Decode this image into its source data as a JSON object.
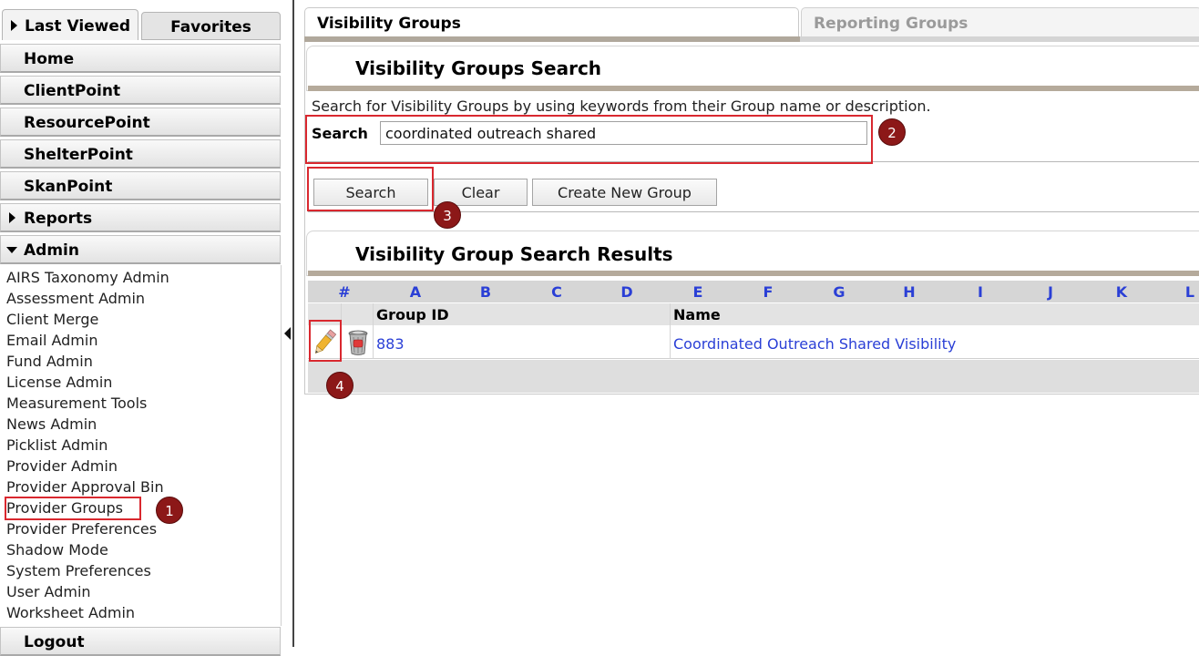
{
  "sidebar": {
    "tabs": [
      "Last Viewed",
      "Favorites"
    ],
    "nav": [
      "Home",
      "ClientPoint",
      "ResourcePoint",
      "ShelterPoint",
      "SkanPoint",
      "Reports",
      "Admin"
    ],
    "admin_items": [
      "AIRS Taxonomy Admin",
      "Assessment Admin",
      "Client Merge",
      "Email Admin",
      "Fund Admin",
      "License Admin",
      "Measurement Tools",
      "News Admin",
      "Picklist Admin",
      "Provider Admin",
      "Provider Approval Bin",
      "Provider Groups",
      "Provider Preferences",
      "Shadow Mode",
      "System Preferences",
      "User Admin",
      "Worksheet Admin"
    ],
    "logout": "Logout"
  },
  "main": {
    "tabs": [
      "Visibility Groups",
      "Reporting Groups"
    ],
    "search_section": {
      "title": "Visibility Groups Search",
      "description": "Search for Visibility Groups by using keywords from their Group name or description.",
      "search_label": "Search",
      "search_value": "coordinated outreach shared",
      "buttons": {
        "search": "Search",
        "clear": "Clear",
        "create": "Create New Group"
      }
    },
    "results_section": {
      "title": "Visibility Group Search Results",
      "alphabet": [
        "#",
        "A",
        "B",
        "C",
        "D",
        "E",
        "F",
        "G",
        "H",
        "I",
        "J",
        "K",
        "L"
      ],
      "columns": [
        "Group ID",
        "Name"
      ],
      "rows": [
        {
          "group_id": "883",
          "name": "Coordinated Outreach Shared Visibility"
        }
      ]
    }
  },
  "annotations": [
    "1",
    "2",
    "3",
    "4"
  ],
  "colors": {
    "link": "#2a3fd6",
    "highlight": "#d9282f",
    "badge": "#8c1818",
    "section_bar": "#b5aa9b"
  },
  "icons": {
    "edit": "pencil-edit-icon",
    "delete": "trash-can-icon"
  }
}
